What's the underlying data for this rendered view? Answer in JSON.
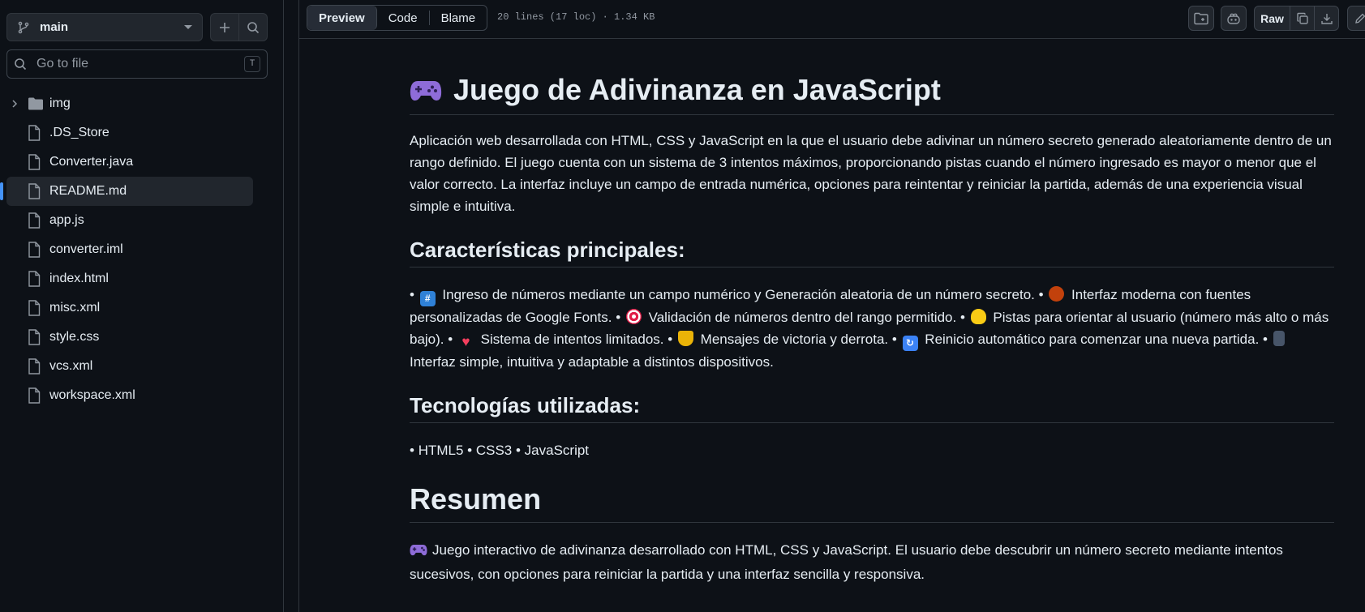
{
  "sidebar": {
    "branch": "main",
    "search_placeholder": "Go to file",
    "search_shortcut": "T",
    "files": [
      {
        "name": "img",
        "type": "folder"
      },
      {
        "name": ".DS_Store",
        "type": "file"
      },
      {
        "name": "Converter.java",
        "type": "file"
      },
      {
        "name": "README.md",
        "type": "file",
        "active": true
      },
      {
        "name": "app.js",
        "type": "file"
      },
      {
        "name": "converter.iml",
        "type": "file"
      },
      {
        "name": "index.html",
        "type": "file"
      },
      {
        "name": "misc.xml",
        "type": "file"
      },
      {
        "name": "style.css",
        "type": "file"
      },
      {
        "name": "vcs.xml",
        "type": "file"
      },
      {
        "name": "workspace.xml",
        "type": "file"
      }
    ]
  },
  "header": {
    "tabs": [
      "Preview",
      "Code",
      "Blame"
    ],
    "selected_tab": "Preview",
    "file_info": "20 lines (17 loc) · 1.34 KB",
    "raw_label": "Raw"
  },
  "readme": {
    "title": "Juego de Adivinanza en JavaScript",
    "intro": "Aplicación web desarrollada con HTML, CSS y JavaScript en la que el usuario debe adivinar un número secreto generado aleatoriamente dentro de un rango definido. El juego cuenta con un sistema de 3 intentos máximos, proporcionando pistas cuando el número ingresado es mayor o menor que el valor correcto. La interfaz incluye un campo de entrada numérica, opciones para reintentar y reiniciar la partida, además de una experiencia visual simple e intuitiva.",
    "features_heading": "Características principales:",
    "features": [
      "Ingreso de números mediante un campo numérico y Generación aleatoria de un número secreto.",
      "Interfaz moderna con fuentes personalizadas de Google Fonts.",
      "Validación de números dentro del rango permitido.",
      "Pistas para orientar al usuario (número más alto o más bajo).",
      "Sistema de intentos limitados.",
      "Mensajes de victoria y derrota.",
      "Reinicio automático para comenzar una nueva partida.",
      "Interfaz simple, intuitiva y adaptable a distintos dispositivos."
    ],
    "tech_heading": "Tecnologías utilizadas:",
    "tech": [
      "HTML5",
      "CSS3",
      "JavaScript"
    ],
    "summary_heading": "Resumen",
    "summary": "Juego interactivo de adivinanza desarrollado con HTML, CSS y JavaScript. El usuario debe descubrir un número secreto mediante intentos sucesivos, con opciones para reiniciar la partida y una interfaz sencilla y responsiva."
  },
  "icons": {
    "feature_icons": [
      "numbers-icon",
      "palette-icon",
      "target-icon",
      "lightbulb-icon",
      "heart-icon",
      "trophy-icon",
      "refresh-icon",
      "phone-icon"
    ],
    "title_icon": "game-controller-icon"
  },
  "colors": {
    "background": "#0d1117",
    "border": "#30363d",
    "accent": "#4493f8",
    "text": "#e6edf3",
    "muted": "#9198a1"
  }
}
